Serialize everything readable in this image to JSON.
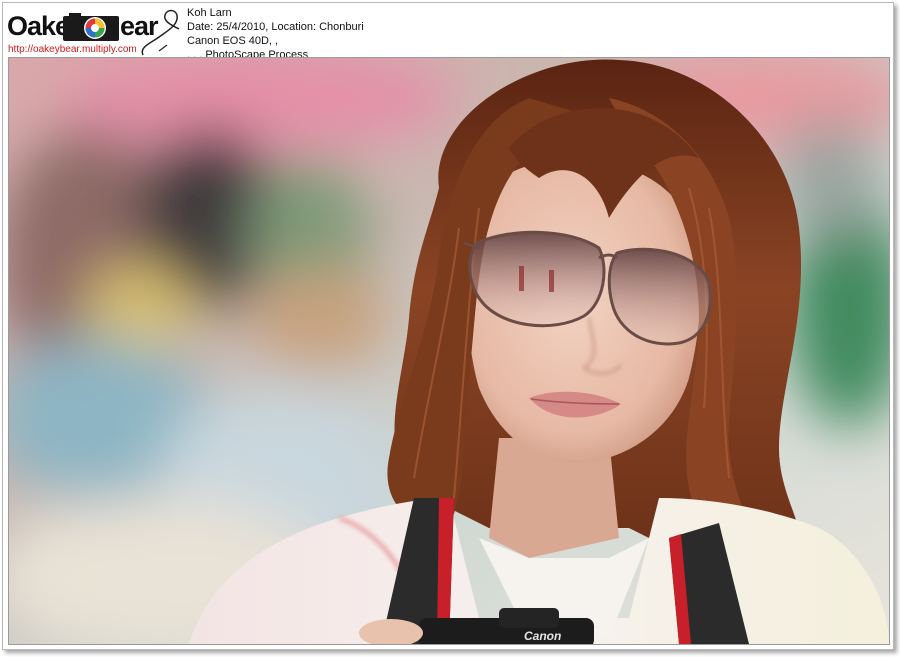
{
  "logo": {
    "text_left": "Oakey",
    "text_right": "ear",
    "url": "http://oakeybear.multiply.com"
  },
  "caption": {
    "title": "Koh Larn",
    "date_location": "Date: 25/4/2010, Location: Chonburi",
    "camera": "Canon EOS 40D, ,",
    "process": ", , , PhotoScape Process"
  },
  "photo": {
    "subject": "woman with sunglasses and camera strap",
    "camera_brand_on_body": "Canon"
  },
  "colors": {
    "hair": "#7a3a1c",
    "skin": "#e9c2ae",
    "frame_border": "#b9b9b9",
    "url_text": "#d21a1a"
  }
}
